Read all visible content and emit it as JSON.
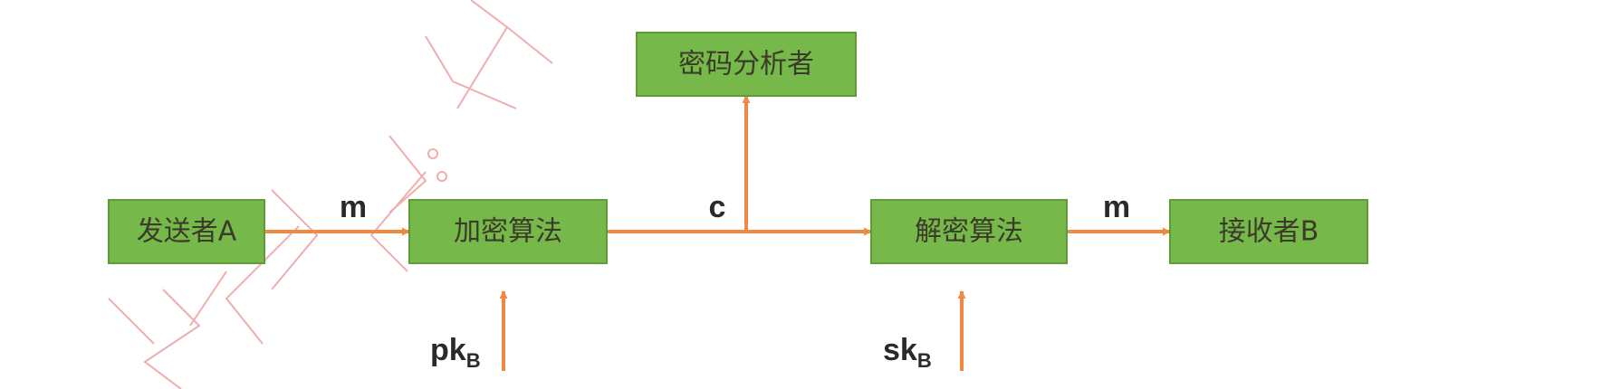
{
  "colors": {
    "node_fill": "#76b84a",
    "node_stroke": "#5f9c36",
    "arrow": "#ee8a45",
    "watermark": "#e24a4a"
  },
  "nodes": {
    "sender": "发送者A",
    "encrypt": "加密算法",
    "cryptanalyst": "密码分析者",
    "decrypt": "解密算法",
    "receiver": "接收者B"
  },
  "edges": {
    "plaintext_in": "m",
    "ciphertext": "c",
    "plaintext_out": "m",
    "public_key": {
      "base": "pk",
      "sub": "B"
    },
    "secret_key": {
      "base": "sk",
      "sub": "B"
    }
  }
}
